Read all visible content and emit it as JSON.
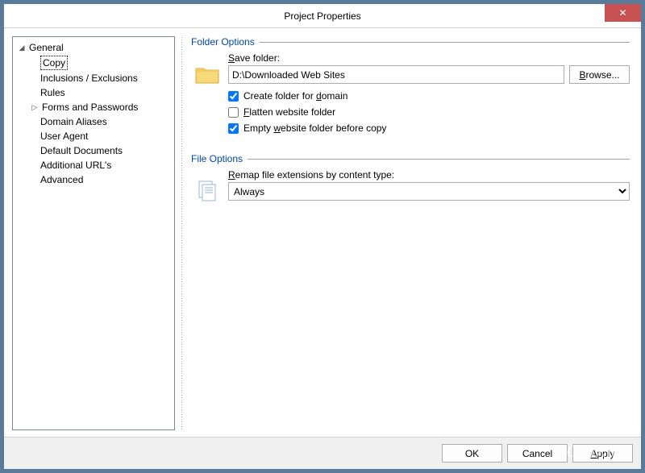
{
  "window": {
    "title": "Project Properties"
  },
  "tree": {
    "root": "General",
    "items": {
      "copy": "Copy",
      "inclusions": "Inclusions / Exclusions",
      "rules": "Rules",
      "forms": "Forms and Passwords",
      "aliases": "Domain Aliases",
      "useragent": "User Agent",
      "defaultdocs": "Default Documents",
      "urls": "Additional URL's",
      "advanced": "Advanced"
    }
  },
  "folderOptions": {
    "title": "Folder Options",
    "saveFolderLabelPre": "S",
    "saveFolderLabelPost": "ave folder:",
    "saveFolderValue": "D:\\Downloaded Web Sites",
    "browseLabelPre": "B",
    "browseLabelPost": "rowse...",
    "createFolderPre": "Create folder for ",
    "createFolderU": "d",
    "createFolderPost": "omain",
    "createFolderChecked": true,
    "flattenU": "F",
    "flattenPost": "latten website folder",
    "flattenChecked": false,
    "emptyPre": "Empty ",
    "emptyU": "w",
    "emptyPost": "ebsite folder before copy",
    "emptyChecked": true
  },
  "fileOptions": {
    "title": "File Options",
    "remapU": "R",
    "remapPost": "emap file extensions by content type:",
    "remapValue": "Always"
  },
  "footer": {
    "ok": "OK",
    "cancel": "Cancel",
    "applyU": "A",
    "applyPost": "pply"
  },
  "watermark": "LO4D.om"
}
